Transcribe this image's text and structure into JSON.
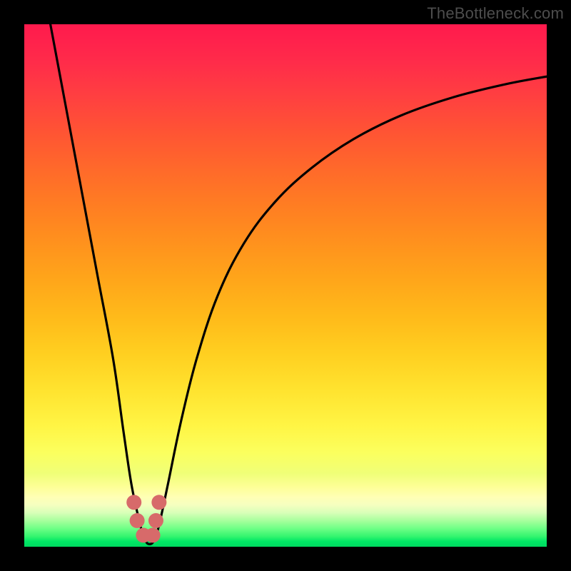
{
  "watermark": {
    "text": "TheBottleneck.com"
  },
  "colors": {
    "curve": "#000000",
    "marker_fill": "#d76a6a",
    "marker_edge": "#b84e55",
    "background_frame": "#000000"
  },
  "chart_data": {
    "type": "line",
    "title": "",
    "xlabel": "",
    "ylabel": "",
    "xlim": [
      0,
      100
    ],
    "ylim": [
      0,
      100
    ],
    "grid": false,
    "legend": false,
    "note": "V-shaped bottleneck curve; values estimated from pixel positions (no axis ticks shown).",
    "series": [
      {
        "name": "bottleneck-curve",
        "x": [
          5,
          8,
          11,
          14,
          17,
          19,
          20.5,
          22,
          23,
          24,
          25,
          26,
          27.5,
          30,
          33,
          37,
          42,
          48,
          55,
          63,
          72,
          82,
          92,
          100
        ],
        "y": [
          100,
          84,
          68,
          52,
          36,
          22,
          12,
          5,
          1.5,
          0.5,
          1.5,
          5,
          12,
          24,
          36,
          48,
          58,
          66,
          72.5,
          78,
          82.5,
          86,
          88.5,
          90
        ]
      }
    ],
    "markers": {
      "name": "highlight-cluster",
      "x": [
        21.0,
        21.6,
        22.8,
        24.6,
        25.2,
        25.8
      ],
      "y": [
        8.5,
        5.0,
        2.2,
        2.2,
        5.0,
        8.5
      ]
    }
  }
}
